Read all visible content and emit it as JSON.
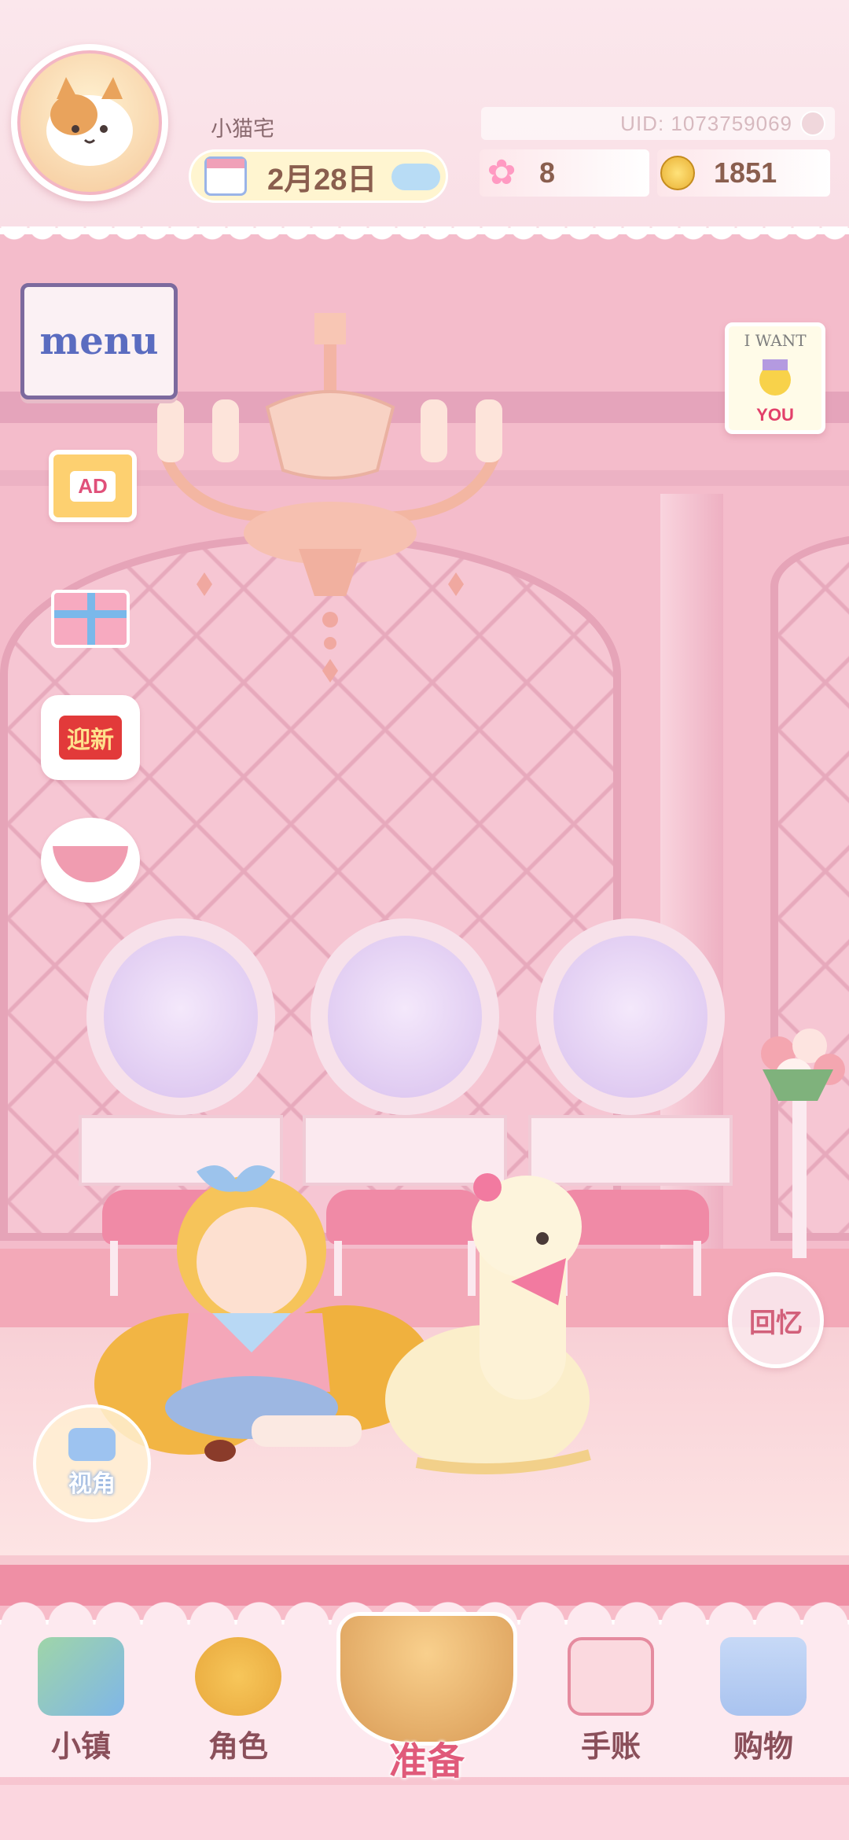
{
  "header": {
    "username": "小猫宅",
    "uid": "UID: 1073759069",
    "date": "2月28日",
    "stars": "8",
    "coins": "1851"
  },
  "side_buttons": {
    "menu_label": "menu",
    "ad_label": "AD",
    "newyear_label": "迎新",
    "recruit_top": "I WANT",
    "recruit_bottom": "YOU"
  },
  "memory_label": "回忆",
  "view_label": "视角",
  "nav": {
    "items": [
      {
        "label": "小镇",
        "icon": "town-map-icon"
      },
      {
        "label": "角色",
        "icon": "character-icon"
      },
      {
        "label": "准备",
        "icon": "picnic-basket-icon"
      },
      {
        "label": "手账",
        "icon": "journal-icon"
      },
      {
        "label": "购物",
        "icon": "shopping-bag-icon"
      }
    ]
  },
  "colors": {
    "primary_pink": "#f4bccb",
    "nav_text": "#8a4f5a",
    "accent": "#e05a7a"
  }
}
